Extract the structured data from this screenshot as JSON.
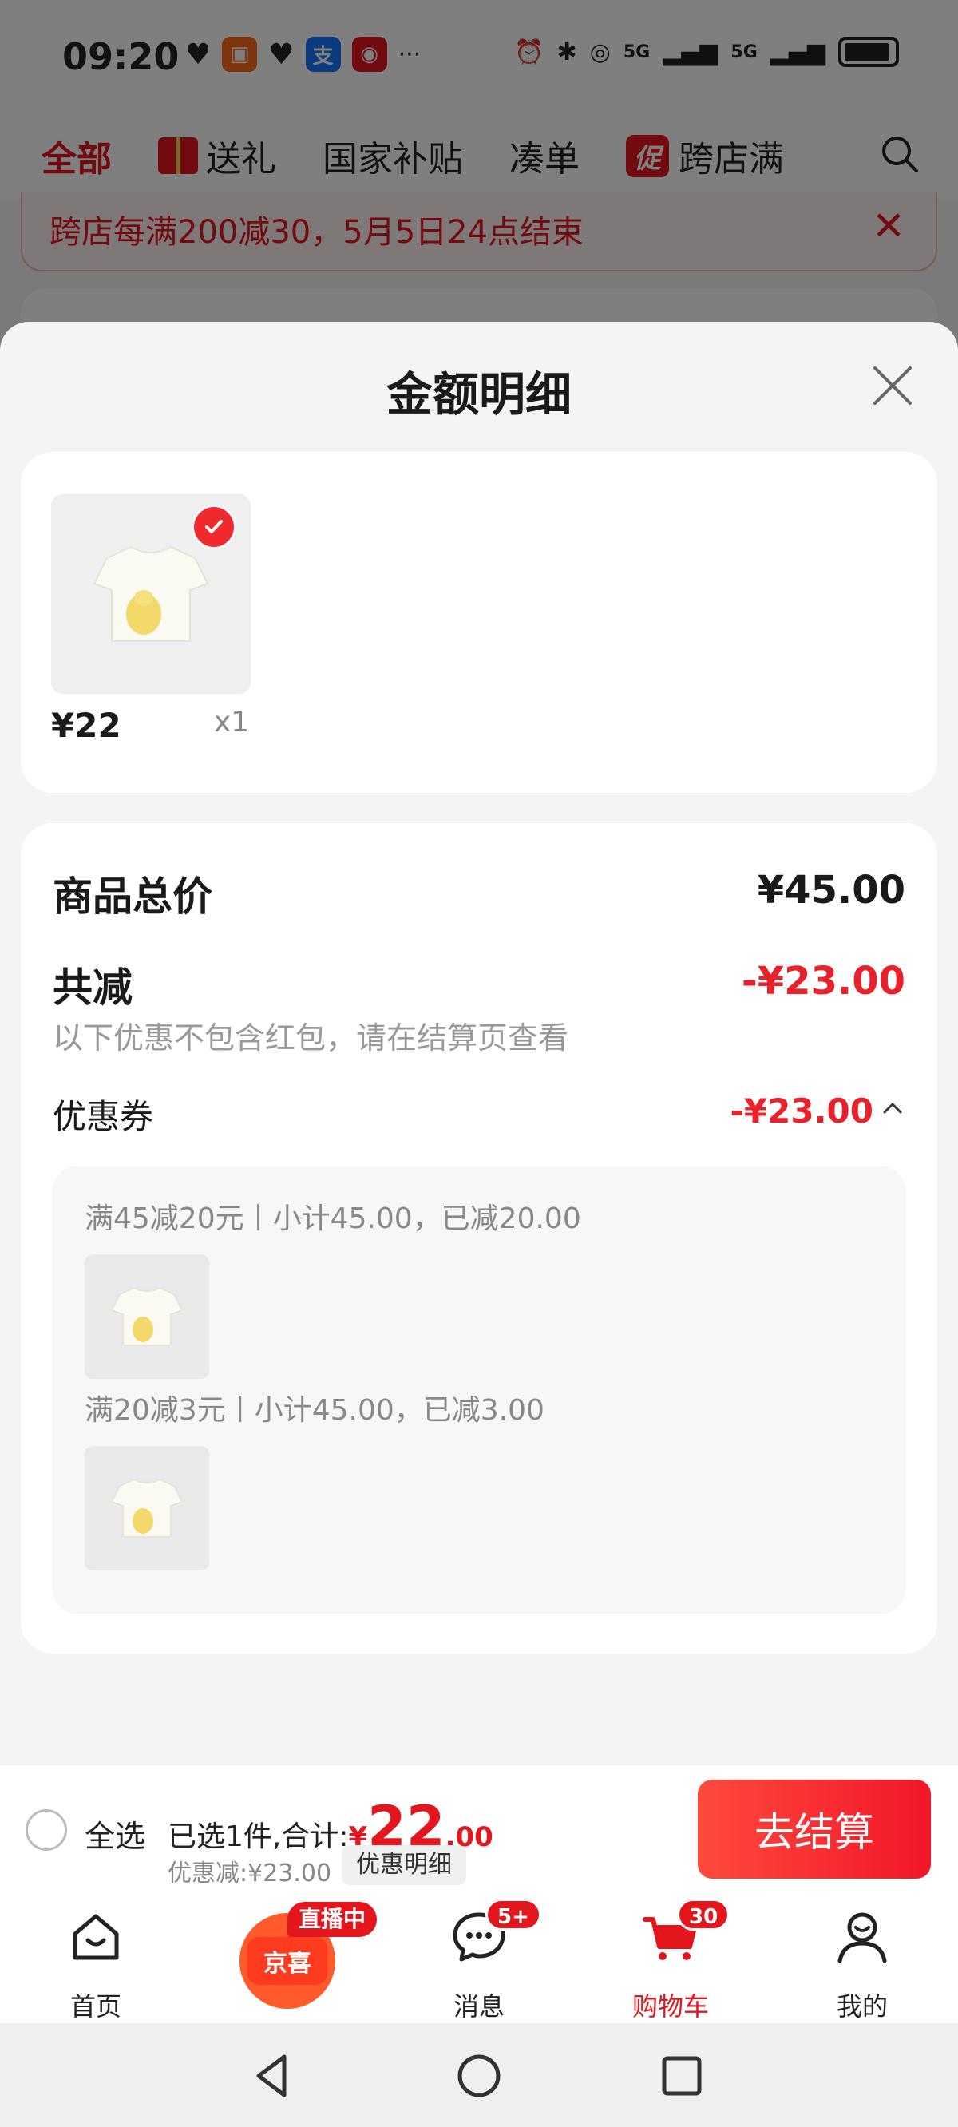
{
  "status_bar": {
    "time": "09:20",
    "more": "···",
    "signal1": "5G",
    "signal2": "5G"
  },
  "top_tabs": {
    "items": [
      "全部",
      "送礼",
      "国家补贴",
      "凑单",
      "跨店满"
    ],
    "promo_badge": "促"
  },
  "promo_strip": {
    "text": "跨店每满200减30，5月5日24点结束",
    "close": "✕"
  },
  "sheet": {
    "title": "金额明细",
    "items": [
      {
        "price": "¥22",
        "qty": "x1"
      }
    ],
    "summary": {
      "total_label": "商品总价",
      "total_value": "¥45.00",
      "reduce_label": "共减",
      "reduce_value": "-¥23.00",
      "reduce_note": "以下优惠不包含红包，请在结算页查看",
      "coupon_label": "优惠券",
      "coupon_value": "-¥23.00"
    },
    "coupons": [
      {
        "text": "满45减20元丨小计45.00，已减20.00"
      },
      {
        "text": "满20减3元丨小计45.00，已减3.00"
      }
    ]
  },
  "checkout": {
    "select_all": "全选",
    "selected_text": "已选1件,合计:",
    "currency": "¥",
    "total_int": "22",
    "total_dec": ".00",
    "discount_text": "优惠减:¥23.00",
    "discount_btn": "优惠明细",
    "checkout_btn": "去结算"
  },
  "bottom_nav": {
    "items": [
      {
        "label": "首页"
      },
      {
        "label": "京喜",
        "badge": "直播中"
      },
      {
        "label": "消息",
        "badge": "5+"
      },
      {
        "label": "购物车",
        "badge": "30"
      },
      {
        "label": "我的"
      }
    ]
  },
  "colors": {
    "accent": "#e3161e",
    "price_red": "#e8222a",
    "checkout_gradient": "#ff4a3c"
  }
}
